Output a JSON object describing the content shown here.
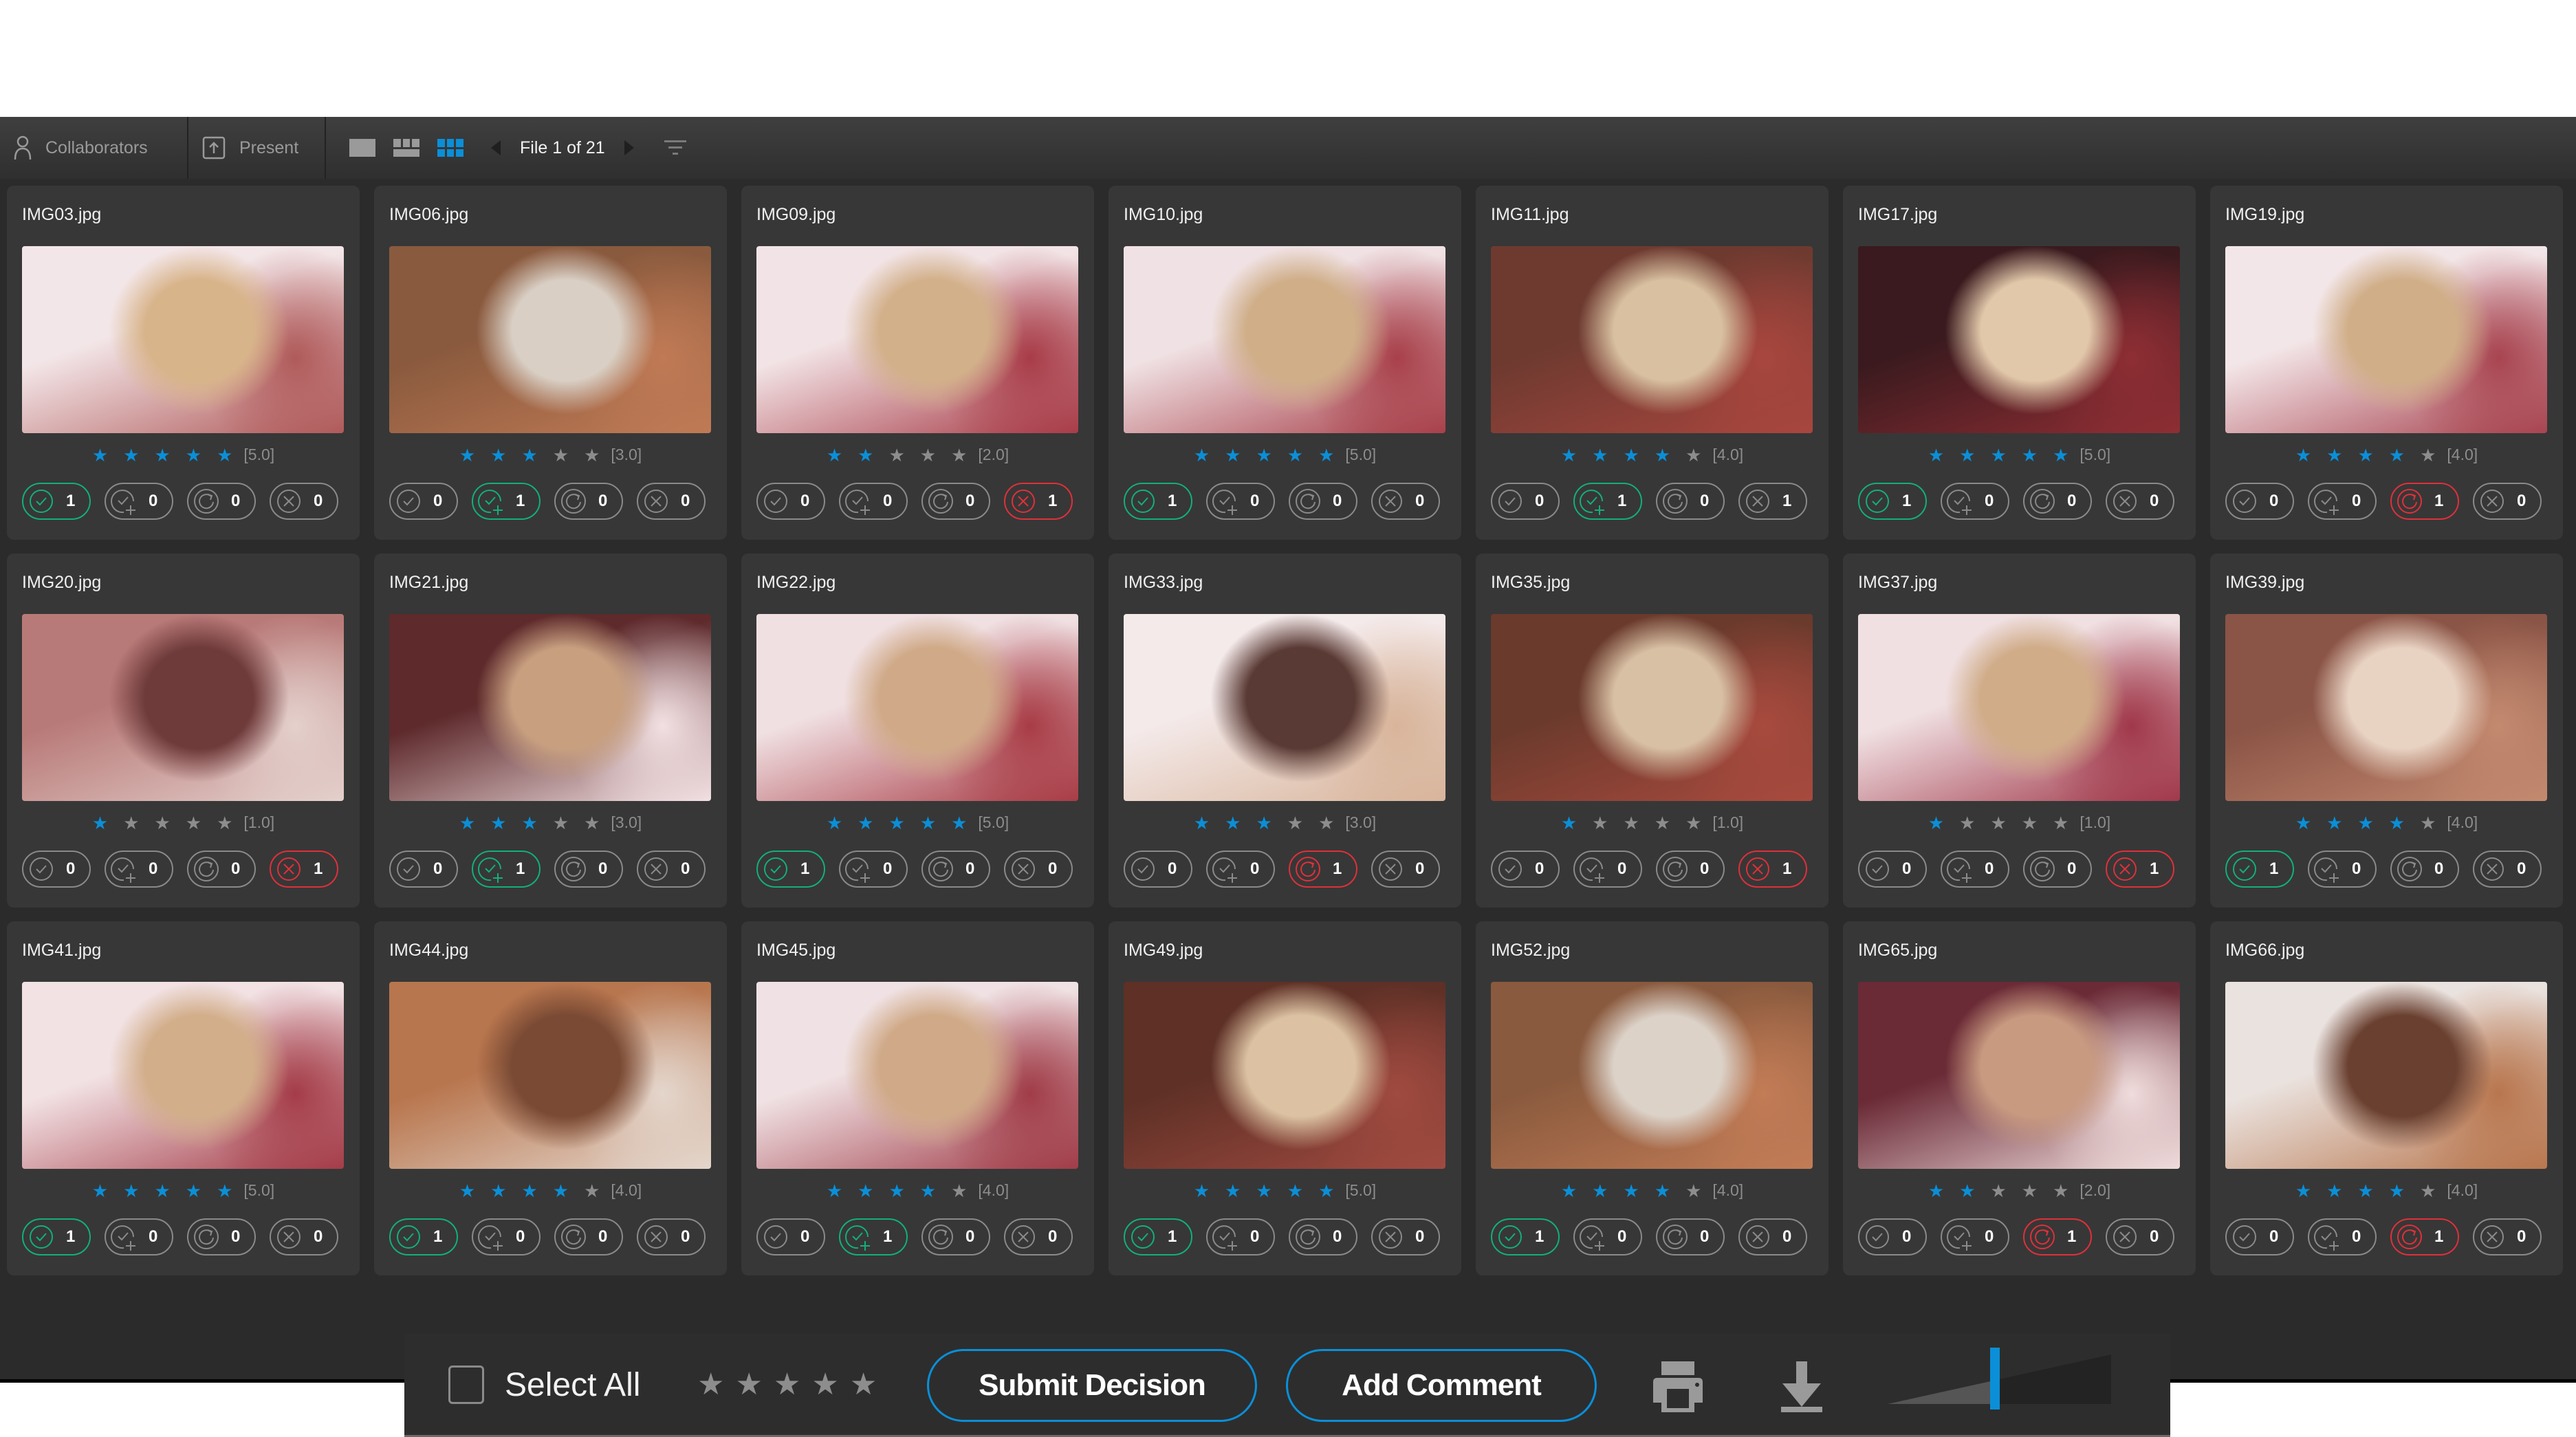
{
  "toolbar": {
    "collaborators_label": "Collaborators",
    "present_label": "Present",
    "view_modes": [
      "single-view",
      "filmstrip-view",
      "grid-view"
    ],
    "active_view": "grid-view",
    "pager_text": "File 1 of 21",
    "accent_color": "#0a8fd8"
  },
  "cards": [
    {
      "name": "IMG03.jpg",
      "rating": 5,
      "rating_text": "[5.0]",
      "approve": 1,
      "approve_changes": 0,
      "revise": 0,
      "reject": 0,
      "active": "approve",
      "palette": [
        "#f3e6e8",
        "#b05a5a",
        "#d8b48a"
      ]
    },
    {
      "name": "IMG06.jpg",
      "rating": 3,
      "rating_text": "[3.0]",
      "approve": 0,
      "approve_changes": 1,
      "revise": 0,
      "reject": 0,
      "active": "approve_changes",
      "palette": [
        "#8a5a3e",
        "#c07a55",
        "#d9cfc4"
      ]
    },
    {
      "name": "IMG09.jpg",
      "rating": 2,
      "rating_text": "[2.0]",
      "approve": 0,
      "approve_changes": 0,
      "revise": 0,
      "reject": 1,
      "active": "reject",
      "palette": [
        "#f2e4e6",
        "#a83c48",
        "#d2b08a"
      ]
    },
    {
      "name": "IMG10.jpg",
      "rating": 5,
      "rating_text": "[5.0]",
      "approve": 1,
      "approve_changes": 0,
      "revise": 0,
      "reject": 0,
      "active": "approve",
      "palette": [
        "#f0e2e4",
        "#a8404a",
        "#cfae88"
      ]
    },
    {
      "name": "IMG11.jpg",
      "rating": 4,
      "rating_text": "[4.0]",
      "approve": 0,
      "approve_changes": 1,
      "revise": 0,
      "reject": 1,
      "active": "approve_changes",
      "palette": [
        "#6e3a30",
        "#a8463e",
        "#d8c0a0"
      ]
    },
    {
      "name": "IMG17.jpg",
      "rating": 5,
      "rating_text": "[5.0]",
      "approve": 1,
      "approve_changes": 0,
      "revise": 0,
      "reject": 0,
      "active": "approve",
      "palette": [
        "#3a1a1e",
        "#8e2e34",
        "#e2c8aa"
      ]
    },
    {
      "name": "IMG19.jpg",
      "rating": 4,
      "rating_text": "[4.0]",
      "approve": 0,
      "approve_changes": 0,
      "revise": 1,
      "reject": 0,
      "active": "revise",
      "palette": [
        "#f3e6e8",
        "#a84450",
        "#d0ae88"
      ]
    },
    {
      "name": "IMG20.jpg",
      "rating": 1,
      "rating_text": "[1.0]",
      "approve": 0,
      "approve_changes": 0,
      "revise": 0,
      "reject": 1,
      "active": "reject",
      "palette": [
        "#b87a78",
        "#e4d0cc",
        "#6e3a3a"
      ]
    },
    {
      "name": "IMG21.jpg",
      "rating": 3,
      "rating_text": "[3.0]",
      "approve": 0,
      "approve_changes": 1,
      "revise": 0,
      "reject": 0,
      "active": "approve_changes",
      "palette": [
        "#5e2a2c",
        "#f2e0e2",
        "#c8a080"
      ]
    },
    {
      "name": "IMG22.jpg",
      "rating": 5,
      "rating_text": "[5.0]",
      "approve": 1,
      "approve_changes": 0,
      "revise": 0,
      "reject": 0,
      "active": "approve",
      "palette": [
        "#f0e0e2",
        "#a83c46",
        "#d0aa88"
      ]
    },
    {
      "name": "IMG33.jpg",
      "rating": 3,
      "rating_text": "[3.0]",
      "approve": 0,
      "approve_changes": 0,
      "revise": 1,
      "reject": 0,
      "active": "revise",
      "palette": [
        "#f4eaea",
        "#d8b49a",
        "#5a3a34"
      ]
    },
    {
      "name": "IMG35.jpg",
      "rating": 1,
      "rating_text": "[1.0]",
      "approve": 0,
      "approve_changes": 0,
      "revise": 0,
      "reject": 1,
      "active": "reject",
      "palette": [
        "#6a3a2c",
        "#a84a3e",
        "#d8c0a4"
      ]
    },
    {
      "name": "IMG37.jpg",
      "rating": 1,
      "rating_text": "[1.0]",
      "approve": 0,
      "approve_changes": 0,
      "revise": 0,
      "reject": 1,
      "active": "reject",
      "palette": [
        "#f0e0e2",
        "#a0384a",
        "#d0ac88"
      ]
    },
    {
      "name": "IMG39.jpg",
      "rating": 4,
      "rating_text": "[4.0]",
      "approve": 1,
      "approve_changes": 0,
      "revise": 0,
      "reject": 0,
      "active": "approve",
      "palette": [
        "#8a5446",
        "#c48a70",
        "#e8d2c2"
      ]
    },
    {
      "name": "IMG41.jpg",
      "rating": 5,
      "rating_text": "[5.0]",
      "approve": 1,
      "approve_changes": 0,
      "revise": 0,
      "reject": 0,
      "active": "approve",
      "palette": [
        "#f2e2e4",
        "#a43c48",
        "#d2ae8a"
      ]
    },
    {
      "name": "IMG44.jpg",
      "rating": 4,
      "rating_text": "[4.0]",
      "approve": 1,
      "approve_changes": 0,
      "revise": 0,
      "reject": 0,
      "active": "approve",
      "palette": [
        "#b8764e",
        "#e4d6cc",
        "#7a4a34"
      ]
    },
    {
      "name": "IMG45.jpg",
      "rating": 4,
      "rating_text": "[4.0]",
      "approve": 0,
      "approve_changes": 1,
      "revise": 0,
      "reject": 0,
      "active": "approve_changes",
      "palette": [
        "#f0e2e4",
        "#a03c48",
        "#d0aa88"
      ]
    },
    {
      "name": "IMG49.jpg",
      "rating": 5,
      "rating_text": "[5.0]",
      "approve": 1,
      "approve_changes": 0,
      "revise": 0,
      "reject": 0,
      "active": "approve",
      "palette": [
        "#5e3026",
        "#a04a40",
        "#dcc2a2"
      ]
    },
    {
      "name": "IMG52.jpg",
      "rating": 4,
      "rating_text": "[4.0]",
      "approve": 1,
      "approve_changes": 0,
      "revise": 0,
      "reject": 0,
      "active": "approve",
      "palette": [
        "#8a5a3e",
        "#c27c56",
        "#dcd2c8"
      ]
    },
    {
      "name": "IMG65.jpg",
      "rating": 2,
      "rating_text": "[2.0]",
      "approve": 0,
      "approve_changes": 0,
      "revise": 1,
      "reject": 0,
      "active": "revise",
      "palette": [
        "#6a2a36",
        "#f0dcdc",
        "#c89a80"
      ]
    },
    {
      "name": "IMG66.jpg",
      "rating": 4,
      "rating_text": "[4.0]",
      "approve": 0,
      "approve_changes": 0,
      "revise": 1,
      "reject": 0,
      "active": "revise",
      "palette": [
        "#eae2de",
        "#b8764e",
        "#6a4030"
      ]
    }
  ],
  "bottom_bar": {
    "select_all_label": "Select All",
    "select_all_checked": false,
    "bulk_rating": 0,
    "submit_label": "Submit Decision",
    "comment_label": "Add Comment",
    "thumbnail_size_fraction": 0.48
  },
  "colors": {
    "approve": "#11b07a",
    "reject": "#e0303a",
    "neutral": "#8a8a8a",
    "star_on": "#0a8fd8",
    "star_off": "#8d8d8d"
  }
}
